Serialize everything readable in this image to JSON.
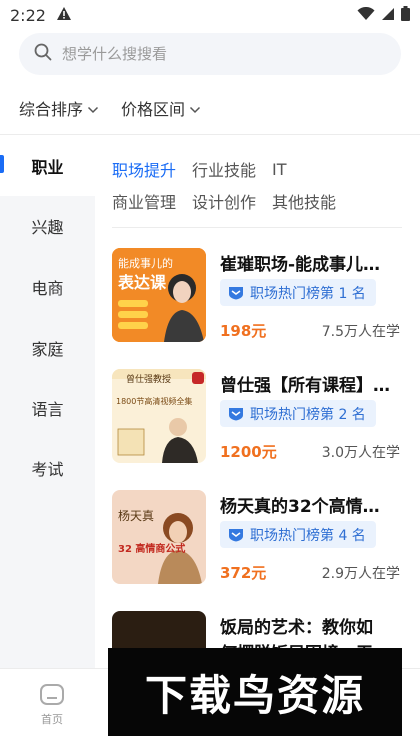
{
  "status": {
    "time": "2:22"
  },
  "search": {
    "placeholder": "想学什么搜搜看"
  },
  "filters": [
    {
      "label": "综合排序"
    },
    {
      "label": "价格区间"
    }
  ],
  "sidebar": {
    "items": [
      {
        "label": "职业",
        "active": true
      },
      {
        "label": "兴趣"
      },
      {
        "label": "电商"
      },
      {
        "label": "家庭"
      },
      {
        "label": "语言"
      },
      {
        "label": "考试"
      }
    ]
  },
  "subcategories": {
    "row1": [
      {
        "label": "职场提升",
        "active": true
      },
      {
        "label": "行业技能"
      },
      {
        "label": "IT"
      }
    ],
    "row2": [
      {
        "label": "商业管理"
      },
      {
        "label": "设计创作"
      },
      {
        "label": "其他技能"
      }
    ]
  },
  "courses": [
    {
      "title": "崔璀职场-能成事儿…",
      "rank": "职场热门榜第 1 名",
      "price": "198元",
      "learners": "7.5万人在学",
      "thumb_text_1": "能成事儿的",
      "thumb_text_2": "表达课"
    },
    {
      "title": "曾仕强【所有课程】…",
      "rank": "职场热门榜第 2 名",
      "price": "1200元",
      "learners": "3.0万人在学",
      "thumb_text_1": "曾仕强教授",
      "thumb_text_2": "1800节高清视频全集"
    },
    {
      "title": "杨天真的32个高情…",
      "rank": "职场热门榜第 4 名",
      "price": "372元",
      "learners": "2.9万人在学",
      "thumb_text_1": "杨天真",
      "thumb_text_2": "32 高情商公式"
    },
    {
      "title": "饭局的艺术：教你如",
      "title_line2": "何摆脱饭局困境，无…"
    }
  ],
  "bottom_nav": {
    "home_label": "首页"
  },
  "watermark": {
    "text": "下载鸟资源"
  }
}
